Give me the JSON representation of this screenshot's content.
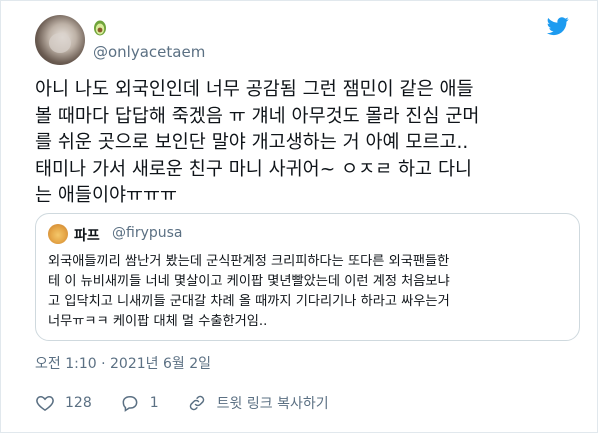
{
  "author": {
    "handle": "@onlyacetaem",
    "emoji_icon": "avocado-icon"
  },
  "tweet": {
    "text": "아니 나도 외국인인데 너무 공감됨 그런 잼민이 같은 애들\n볼 때마다 답답해 죽겠음 ㅠ 걔네 아무것도 몰라 진심 군머\n를 쉬운 곳으로 보인단 말야 개고생하는 거 아예 모르고..\n태미나 가서 새로운 친구 마니 사귀어~ ㅇㅈㄹ 하고 다니\n는 애들이야ㅠㅠㅠ",
    "timestamp": "오전 1:10 · 2021년 6월 2일"
  },
  "quote": {
    "name": "파프",
    "handle": "@firypusa",
    "text": "외국애들끼리 쌈난거 봤는데 군식판계정 크리피하다는 또다른 외국팬들한\n테 이 뉴비새끼들 너네 몇살이고 케이팝 몇년빨았는데 이런 계정 처음보냐\n고 입닥치고 니새끼들 군대갈 차례 올 때까지 기다리기나 하라고 싸우는거\n너무ㅠㅋㅋ 케이팝 대체 멀 수출한거임.."
  },
  "actions": {
    "like_count": "128",
    "reply_count": "1",
    "share_label": "트윗 링크 복사하기"
  },
  "colors": {
    "brand": "#1d9bf0",
    "muted": "#5b7083",
    "border": "#cfd9de"
  }
}
